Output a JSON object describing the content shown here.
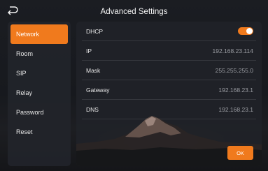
{
  "header": {
    "title": "Advanced Settings",
    "back_icon": "back-arrow-icon"
  },
  "sidebar": {
    "items": [
      {
        "label": "Network",
        "active": true
      },
      {
        "label": "Room",
        "active": false
      },
      {
        "label": "SIP",
        "active": false
      },
      {
        "label": "Relay",
        "active": false
      },
      {
        "label": "Password",
        "active": false
      },
      {
        "label": "Reset",
        "active": false
      }
    ]
  },
  "network": {
    "dhcp": {
      "label": "DHCP",
      "enabled": true
    },
    "ip": {
      "label": "IP",
      "value": "192.168.23.114"
    },
    "mask": {
      "label": "Mask",
      "value": "255.255.255.0"
    },
    "gateway": {
      "label": "Gateway",
      "value": "192.168.23.1"
    },
    "dns": {
      "label": "DNS",
      "value": "192.168.23.1"
    }
  },
  "actions": {
    "ok_label": "OK"
  },
  "colors": {
    "accent": "#f07a1d",
    "background": "#17191e",
    "panel": "#202228",
    "text": "#e8e8e8",
    "value_text": "#9a9ca2"
  }
}
